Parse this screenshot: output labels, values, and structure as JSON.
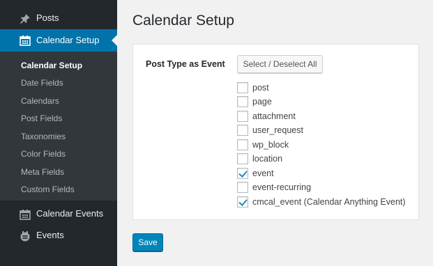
{
  "sidebar": {
    "posts": "Posts",
    "calendar_setup": "Calendar Setup",
    "submenu": [
      "Calendar Setup",
      "Date Fields",
      "Calendars",
      "Post Fields",
      "Taxonomies",
      "Color Fields",
      "Meta Fields",
      "Custom Fields"
    ],
    "calendar_events": "Calendar Events",
    "events": "Events"
  },
  "main": {
    "title": "Calendar Setup",
    "field_label": "Post Type as Event",
    "select_all_label": "Select / Deselect All",
    "options": [
      {
        "label": "post",
        "checked": false
      },
      {
        "label": "page",
        "checked": false
      },
      {
        "label": "attachment",
        "checked": false
      },
      {
        "label": "user_request",
        "checked": false
      },
      {
        "label": "wp_block",
        "checked": false
      },
      {
        "label": "location",
        "checked": false
      },
      {
        "label": "event",
        "checked": true
      },
      {
        "label": "event-recurring",
        "checked": false
      },
      {
        "label": "cmcal_event (Calendar Anything Event)",
        "checked": true
      }
    ],
    "save_label": "Save"
  },
  "colors": {
    "sidebar_bg": "#23282d",
    "submenu_bg": "#32373c",
    "accent": "#0073aa",
    "save_button": "#0085ba"
  },
  "icons": {
    "posts": "pushpin-icon",
    "calendar_setup": "calendar-icon",
    "calendar_events": "calendar-icon",
    "events": "calendar-badge-icon"
  }
}
